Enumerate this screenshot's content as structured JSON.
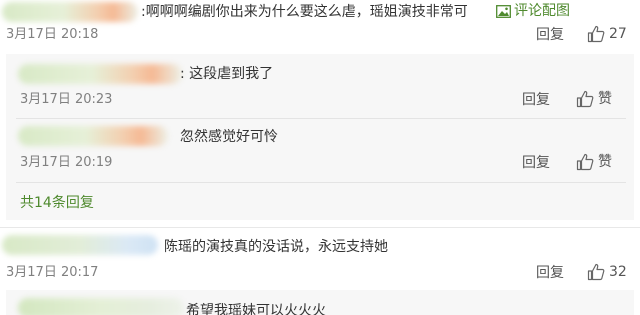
{
  "comments": [
    {
      "text": ":啊啊啊编剧你出来为什么要这么虐，瑶姐演技非常可",
      "time": "3月17日 20:18",
      "reply_label": "回复",
      "like_count": "27",
      "pic_label": "评论配图"
    },
    {
      "text": "陈瑶的演技真的没话说，永远支持她",
      "time": "3月17日 20:17",
      "reply_label": "回复",
      "like_count": "32"
    }
  ],
  "replies": [
    {
      "text": ": 这段虐到我了",
      "time": "3月17日 20:23",
      "reply_label": "回复",
      "like_label": "赞"
    },
    {
      "text": "忽然感觉好可怜",
      "time": "3月17日 20:19",
      "reply_label": "回复",
      "like_label": "赞"
    }
  ],
  "more_replies_label": "共14条回复",
  "partial_reply": {
    "text": "希望我瑶妹可以火火火"
  },
  "colors": {
    "link_green": "#4f8a2e",
    "text": "#333333",
    "meta": "#808080",
    "reply_bg": "#f7f7f7"
  }
}
